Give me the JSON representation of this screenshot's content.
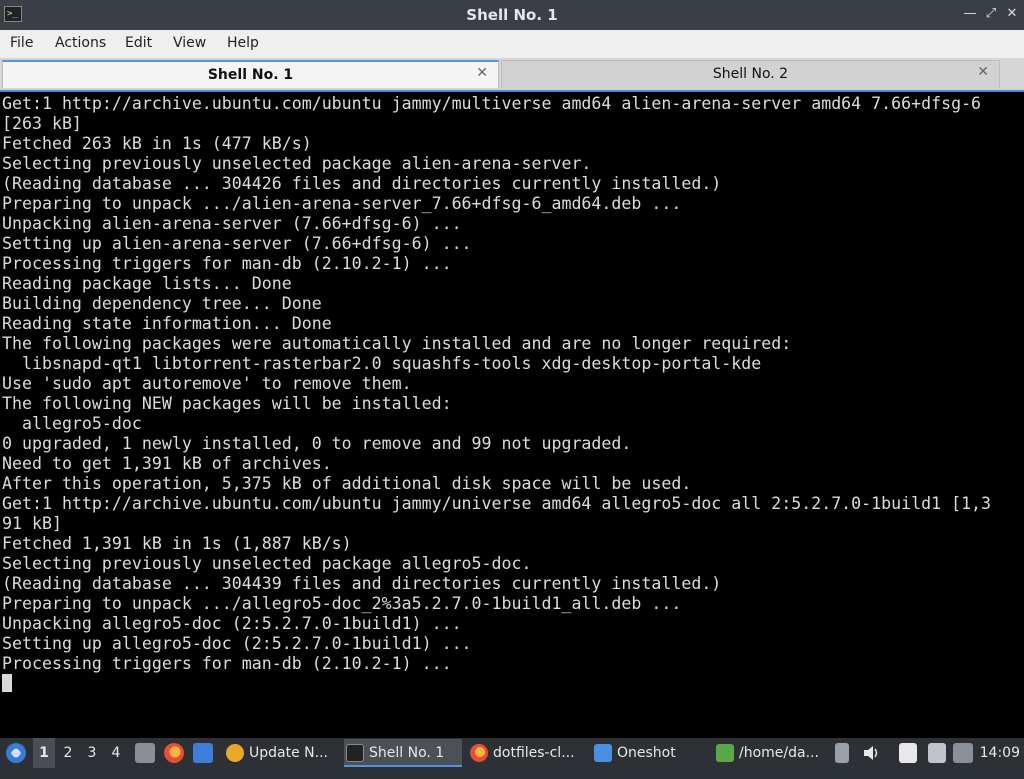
{
  "window": {
    "title": "Shell No. 1"
  },
  "menu": [
    "File",
    "Actions",
    "Edit",
    "View",
    "Help"
  ],
  "tabs": [
    {
      "label": "Shell No. 1",
      "active": true
    },
    {
      "label": "Shell No. 2",
      "active": false
    }
  ],
  "terminal": {
    "lines": [
      "Get:1 http://archive.ubuntu.com/ubuntu jammy/multiverse amd64 alien-arena-server amd64 7.66+dfsg-6",
      "[263 kB]",
      "Fetched 263 kB in 1s (477 kB/s)",
      "Selecting previously unselected package alien-arena-server.",
      "(Reading database ... 304426 files and directories currently installed.)",
      "Preparing to unpack .../alien-arena-server_7.66+dfsg-6_amd64.deb ...",
      "Unpacking alien-arena-server (7.66+dfsg-6) ...",
      "Setting up alien-arena-server (7.66+dfsg-6) ...",
      "Processing triggers for man-db (2.10.2-1) ...",
      "Reading package lists... Done",
      "Building dependency tree... Done",
      "Reading state information... Done",
      "The following packages were automatically installed and are no longer required:",
      "  libsnapd-qt1 libtorrent-rasterbar2.0 squashfs-tools xdg-desktop-portal-kde",
      "Use 'sudo apt autoremove' to remove them.",
      "The following NEW packages will be installed:",
      "  allegro5-doc",
      "0 upgraded, 1 newly installed, 0 to remove and 99 not upgraded.",
      "Need to get 1,391 kB of archives.",
      "After this operation, 5,375 kB of additional disk space will be used.",
      "Get:1 http://archive.ubuntu.com/ubuntu jammy/universe amd64 allegro5-doc all 2:5.2.7.0-1build1 [1,3",
      "91 kB]",
      "Fetched 1,391 kB in 1s (1,887 kB/s)",
      "Selecting previously unselected package allegro5-doc.",
      "(Reading database ... 304439 files and directories currently installed.)",
      "Preparing to unpack .../allegro5-doc_2%3a5.2.7.0-1build1_all.deb ...",
      "Unpacking allegro5-doc (2:5.2.7.0-1build1) ...",
      "Setting up allegro5-doc (2:5.2.7.0-1build1) ...",
      "Processing triggers for man-db (2.10.2-1) ..."
    ]
  },
  "taskbar": {
    "workspaces": [
      "1",
      "2",
      "3",
      "4"
    ],
    "active_workspace": "1",
    "tasks": [
      {
        "label": "Update N...",
        "icon": "update-icon",
        "active": false
      },
      {
        "label": "Shell No. 1",
        "icon": "terminal-icon",
        "active": true
      },
      {
        "label": "dotfiles-cl...",
        "icon": "firefox-icon",
        "active": false
      },
      {
        "label": "Oneshot",
        "icon": "folder-icon",
        "active": false
      },
      {
        "label": "/home/da...",
        "icon": "editor-icon",
        "active": false
      }
    ],
    "clock": "14:09"
  },
  "colors": {
    "accent": "#5294e2",
    "terminal_bg": "#000000",
    "terminal_fg": "#dcdcdc"
  }
}
